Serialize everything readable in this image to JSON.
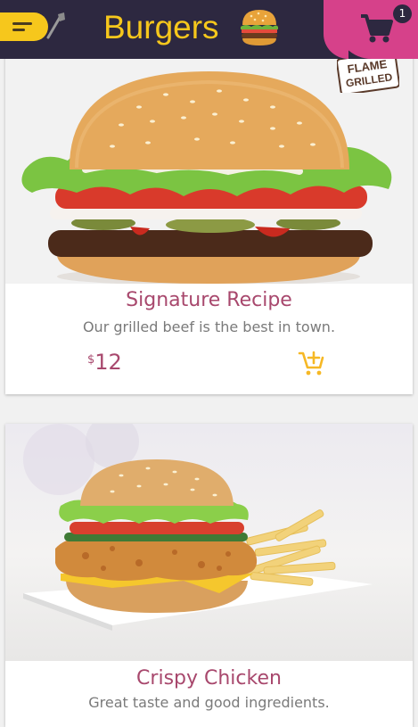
{
  "header": {
    "title": "Burgers",
    "cart_count": "1",
    "menu_icon": "menu-icon",
    "cart_icon": "cart-icon"
  },
  "products": [
    {
      "name": "Signature Recipe",
      "description": "Our grilled beef is the best in town.",
      "currency": "$",
      "price": "12",
      "badge_text_1": "FLAME",
      "badge_text_2": "GRILLED"
    },
    {
      "name": "Crispy Chicken",
      "description": "Great taste and good ingredients."
    }
  ],
  "colors": {
    "header_bg": "#2d2840",
    "accent_yellow": "#f6c71c",
    "accent_pink": "#d6418a",
    "title_text": "#a8486d"
  }
}
